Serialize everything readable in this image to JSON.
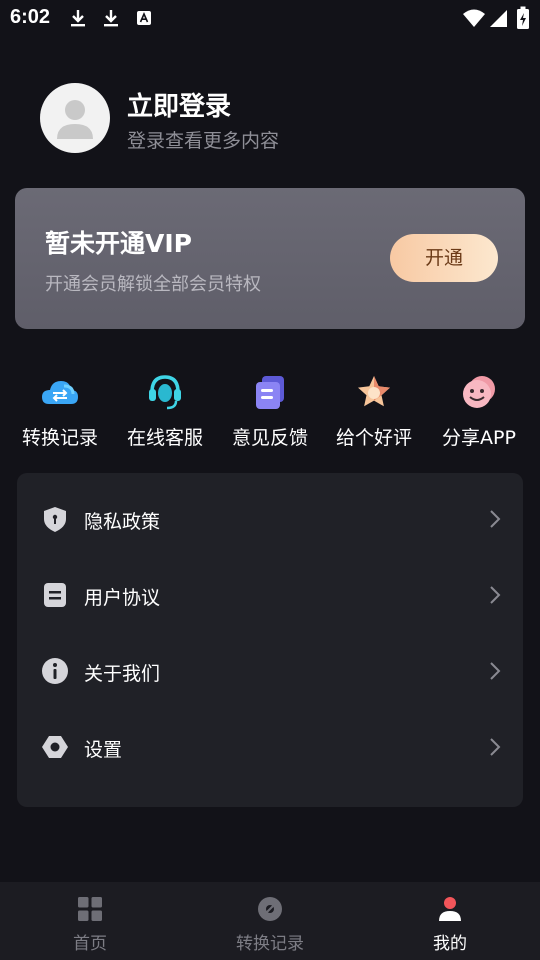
{
  "status_bar": {
    "time": "6:02",
    "left_icons": [
      "download-icon",
      "download-icon",
      "a-notification-icon"
    ],
    "right_icons": [
      "wifi-icon",
      "signal-icon",
      "battery-charging-icon"
    ]
  },
  "profile": {
    "avatar_icon": "user-placeholder-icon",
    "title": "立即登录",
    "subtitle": "登录查看更多内容"
  },
  "vip": {
    "title": "暂未开通VIP",
    "subtitle": "开通会员解锁全部会员特权",
    "button_label": "开通",
    "button_colors": [
      "#f8c9a3",
      "#fce8cf"
    ]
  },
  "quick_actions": [
    {
      "label": "转换记录",
      "icon": "cloud-transfer-icon"
    },
    {
      "label": "在线客服",
      "icon": "headset-icon"
    },
    {
      "label": "意见反馈",
      "icon": "feedback-document-icon"
    },
    {
      "label": "给个好评",
      "icon": "star-icon"
    },
    {
      "label": "分享APP",
      "icon": "smiley-share-icon"
    }
  ],
  "menu": [
    {
      "label": "隐私政策",
      "icon": "shield-icon"
    },
    {
      "label": "用户协议",
      "icon": "agreement-document-icon"
    },
    {
      "label": "关于我们",
      "icon": "info-icon"
    },
    {
      "label": "设置",
      "icon": "gear-icon"
    }
  ],
  "tabbar": [
    {
      "label": "首页",
      "icon": "grid-home-icon",
      "active": false
    },
    {
      "label": "转换记录",
      "icon": "record-disc-icon",
      "active": false
    },
    {
      "label": "我的",
      "icon": "person-icon",
      "active": true
    }
  ],
  "colors": {
    "background": "#121218",
    "card": "#202127",
    "vip_card": "#65646f",
    "active_tab_accent": "#f2555a"
  }
}
